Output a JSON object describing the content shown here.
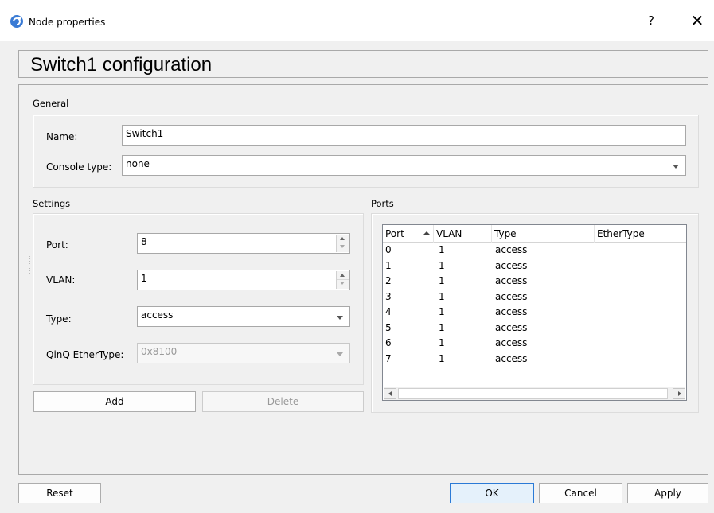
{
  "window": {
    "title": "Node properties",
    "help_label": "?",
    "close_icon": "close-icon",
    "app_icon": "gns3-app-icon"
  },
  "heading": "Switch1 configuration",
  "general": {
    "label": "General",
    "name_label": "Name:",
    "name_value": "Switch1",
    "console_label": "Console type:",
    "console_value": "none"
  },
  "settings": {
    "label": "Settings",
    "port_label": "Port:",
    "port_value": "8",
    "vlan_label": "VLAN:",
    "vlan_value": "1",
    "type_label": "Type:",
    "type_value": "access",
    "qinq_label": "QinQ EtherType:",
    "qinq_value": "0x8100"
  },
  "actions": {
    "add_prefix": "",
    "add_mnemonic": "A",
    "add_suffix": "dd",
    "delete_prefix": "",
    "delete_mnemonic": "D",
    "delete_suffix": "elete"
  },
  "ports": {
    "label": "Ports",
    "columns": [
      "Port",
      "VLAN",
      "Type",
      "EtherType"
    ],
    "rows": [
      {
        "port": "0",
        "vlan": "1",
        "type": "access",
        "ethertype": ""
      },
      {
        "port": "1",
        "vlan": "1",
        "type": "access",
        "ethertype": ""
      },
      {
        "port": "2",
        "vlan": "1",
        "type": "access",
        "ethertype": ""
      },
      {
        "port": "3",
        "vlan": "1",
        "type": "access",
        "ethertype": ""
      },
      {
        "port": "4",
        "vlan": "1",
        "type": "access",
        "ethertype": ""
      },
      {
        "port": "5",
        "vlan": "1",
        "type": "access",
        "ethertype": ""
      },
      {
        "port": "6",
        "vlan": "1",
        "type": "access",
        "ethertype": ""
      },
      {
        "port": "7",
        "vlan": "1",
        "type": "access",
        "ethertype": ""
      }
    ]
  },
  "footer": {
    "reset": "Reset",
    "ok": "OK",
    "cancel": "Cancel",
    "apply": "Apply"
  },
  "colors": {
    "accent": "#2b7ad6",
    "dialog_bg": "#f0f0f0"
  }
}
